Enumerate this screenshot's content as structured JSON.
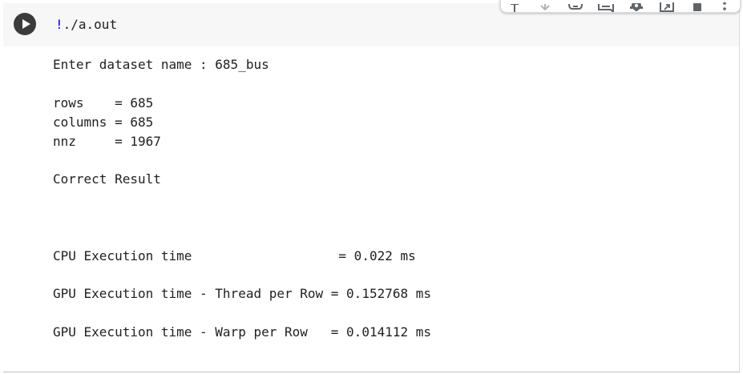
{
  "cell": {
    "code": {
      "prefix": "!",
      "command": "./a.out"
    },
    "toolbar": {
      "icons": [
        "move-up-icon",
        "move-down-icon",
        "link-icon",
        "comment-icon",
        "settings-icon",
        "open-in-tab-icon",
        "delete-icon",
        "more-vert-icon"
      ]
    },
    "output": {
      "lines": [
        "Enter dataset name : 685_bus",
        "rows    = 685",
        "columns = 685",
        "nnz     = 1967",
        "Correct Result",
        "CPU Execution time                   = 0.022 ms",
        "GPU Execution time - Thread per Row = 0.152768 ms",
        "GPU Execution time - Warp per Row   = 0.014112 ms"
      ]
    }
  },
  "colors": {
    "run_button": "#3b3b3b",
    "input_background": "#f7f7f7",
    "bang": "#0000ff",
    "text": "#212121"
  }
}
